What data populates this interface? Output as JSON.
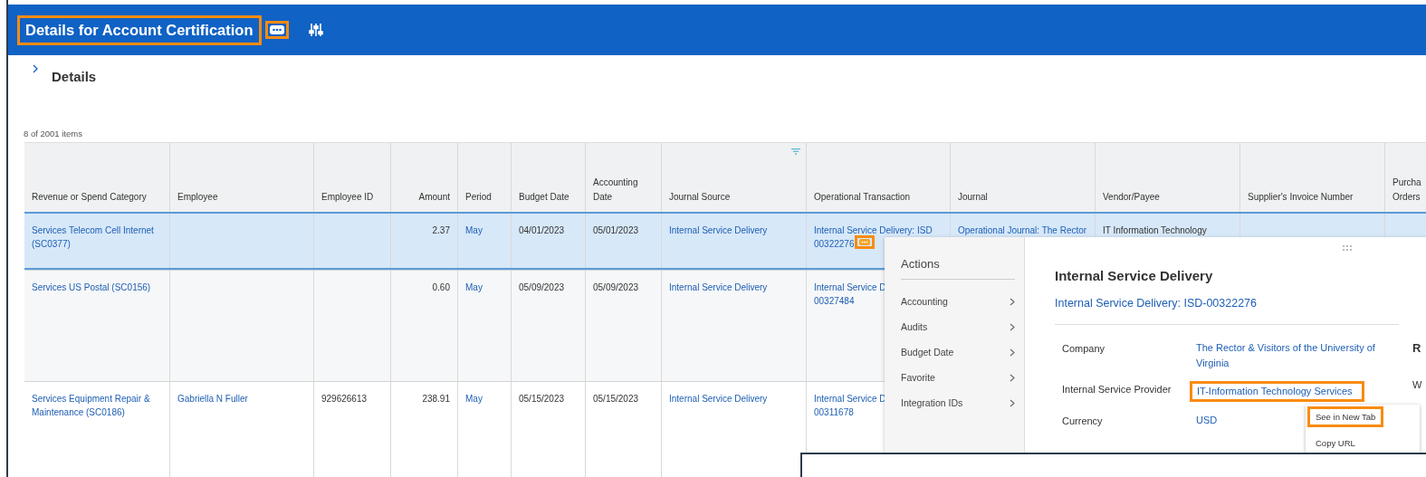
{
  "header": {
    "title": "Details for Account Certification",
    "title_highlighted": true,
    "more_highlighted": true
  },
  "section": {
    "title": "Details",
    "expanded": false
  },
  "table": {
    "count": "8 of 2001 items",
    "columns": [
      {
        "label": "Revenue or Spend Category",
        "filter": false
      },
      {
        "label": "Employee",
        "filter": false
      },
      {
        "label": "Employee ID",
        "filter": false
      },
      {
        "label": "Amount",
        "filter": false
      },
      {
        "label": "Period",
        "filter": false
      },
      {
        "label": "Budget Date",
        "filter": false
      },
      {
        "label": "Accounting\nDate",
        "filter": false
      },
      {
        "label": "Journal Source",
        "filter": true
      },
      {
        "label": "Operational Transaction",
        "filter": false
      },
      {
        "label": "Journal",
        "filter": false
      },
      {
        "label": "Vendor/Payee",
        "filter": false
      },
      {
        "label": "Supplier's Invoice Number",
        "filter": false
      },
      {
        "label": "Purcha\nOrders",
        "filter": false
      }
    ],
    "rows": [
      {
        "selected": true,
        "cells": [
          {
            "text": "Services Telecom Cell Internet\n(SC0377)",
            "link": true
          },
          null,
          null,
          {
            "text": "2.37",
            "link": false
          },
          {
            "text": "May",
            "link": true
          },
          {
            "text": "04/01/2023",
            "link": false
          },
          {
            "text": "05/01/2023",
            "link": false
          },
          {
            "text": "Internal Service Delivery",
            "link": true
          },
          {
            "text": "Internal Service Delivery: ISD\n00322276",
            "link": true,
            "menu_button": {
              "highlighted": true
            }
          },
          {
            "text": "Operational Journal: The Rector",
            "link": true
          },
          {
            "text": "IT Information Technology",
            "link": false
          },
          null,
          null
        ]
      },
      {
        "selected": false,
        "cells": [
          {
            "text": "Services US Postal (SC0156)",
            "link": true
          },
          null,
          null,
          {
            "text": "0.60",
            "link": false
          },
          {
            "text": "May",
            "link": true
          },
          {
            "text": "05/09/2023",
            "link": false
          },
          {
            "text": "05/09/2023",
            "link": false
          },
          {
            "text": "Internal Service Delivery",
            "link": true
          },
          {
            "text": "Internal Service D\n00327484",
            "link": true
          },
          null,
          null,
          null,
          null
        ]
      },
      {
        "selected": false,
        "cells": [
          {
            "text": "Services Equipment Repair &\nMaintenance (SC0186)",
            "link": true
          },
          {
            "text": "Gabriella N Fuller",
            "link": true
          },
          {
            "text": "929626613",
            "link": false
          },
          {
            "text": "238.91",
            "link": false
          },
          {
            "text": "May",
            "link": true
          },
          {
            "text": "05/15/2023",
            "link": false
          },
          {
            "text": "05/15/2023",
            "link": false
          },
          {
            "text": "Internal Service Delivery",
            "link": true
          },
          {
            "text": "Internal Service D\n00311678",
            "link": true
          },
          null,
          null,
          null,
          null
        ]
      }
    ]
  },
  "popup": {
    "actions_title": "Actions",
    "actions": [
      "Accounting",
      "Audits",
      "Budget Date",
      "Favorite",
      "Integration IDs"
    ],
    "title": "Internal Service Delivery",
    "link": "Internal Service Delivery: ISD-00322276",
    "fields": [
      {
        "label": "Company",
        "value": "The Rector & Visitors of the University of Virginia",
        "highlighted": false
      },
      {
        "label": "Internal Service Provider",
        "value": "IT-Information Technology Services",
        "highlighted": true
      },
      {
        "label": "Currency",
        "value": "USD",
        "highlighted": false
      }
    ],
    "side_heading": "R",
    "side_text": "W",
    "context_menu": [
      {
        "label": "See in New Tab",
        "highlighted": true
      },
      {
        "label": "Copy URL",
        "highlighted": false
      }
    ]
  }
}
